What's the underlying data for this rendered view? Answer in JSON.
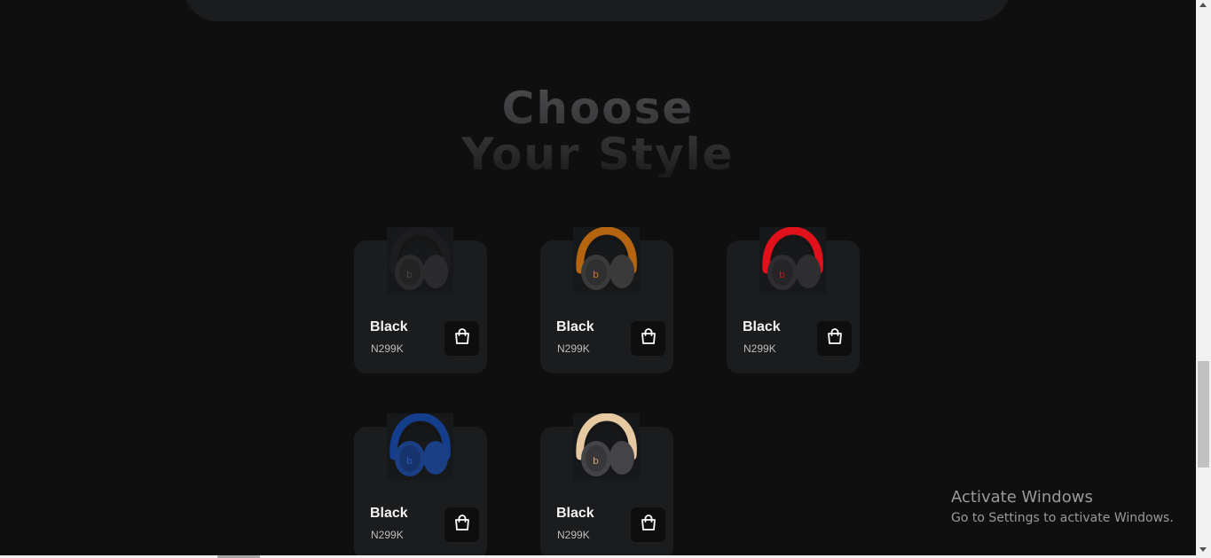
{
  "heading": {
    "line1": "Choose",
    "line2": "Your Style"
  },
  "products": [
    {
      "name": "Black",
      "price": "N299K",
      "color": "black",
      "band": "#1d1d1f",
      "cup": "#2b2b2d",
      "accent": "#444"
    },
    {
      "name": "Black",
      "price": "N299K",
      "color": "brown",
      "band": "#b5650f",
      "cup": "#3b3a3a",
      "accent": "#c67b1c"
    },
    {
      "name": "Black",
      "price": "N299K",
      "color": "red",
      "band": "#e0111b",
      "cup": "#2e2e30",
      "accent": "#d0101a"
    },
    {
      "name": "Black",
      "price": "N299K",
      "color": "blue",
      "band": "#143e8c",
      "cup": "#1b3f85",
      "accent": "#2a5bb6"
    },
    {
      "name": "Black",
      "price": "N299K",
      "color": "gold",
      "band": "#e6c9a0",
      "cup": "#444446",
      "accent": "#cfa36b"
    }
  ],
  "watermark": {
    "title": "Activate Windows",
    "subtitle": "Go to Settings to activate Windows."
  },
  "icons": {
    "cart": "shopping-bag-icon",
    "headphones": "headphones-image"
  }
}
